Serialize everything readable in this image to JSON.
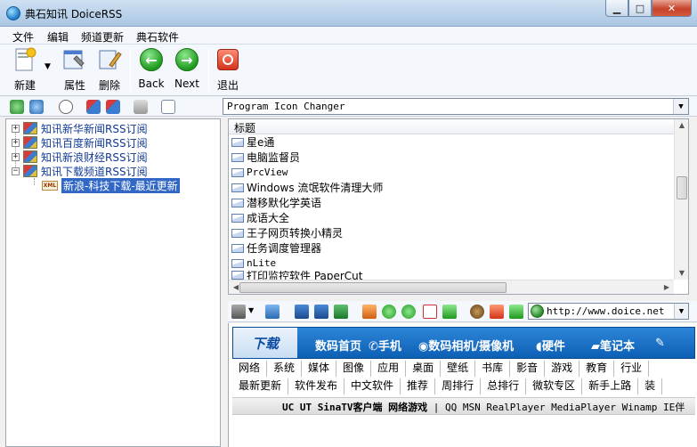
{
  "window": {
    "title": "典石知讯 DoiceRSS"
  },
  "menu": [
    "文件",
    "编辑",
    "频道更新",
    "典石软件"
  ],
  "toolbar": {
    "new_label": "新建",
    "properties_label": "属性",
    "delete_label": "删除",
    "back_label": "Back",
    "next_label": "Next",
    "exit_label": "退出"
  },
  "filter": {
    "selected": "Program Icon Changer"
  },
  "tree": {
    "items": [
      "知讯新华新闻RSS订阅",
      "知讯百度新闻RSS订阅",
      "知讯新浪财经RSS订阅",
      "知讯下载频道RSS订阅"
    ],
    "child": "新浪-科技下载-最近更新"
  },
  "list": {
    "header": "标题",
    "rows": [
      "星e通",
      "电脑监督员",
      "PrcView",
      "Windows 流氓软件清理大师",
      "潜移默化学英语",
      "成语大全",
      "王子网页转换小精灵",
      "任务调度管理器",
      "nLite",
      "打印监控软件 PaperCut"
    ]
  },
  "browser": {
    "url": "http://www.doice.net"
  },
  "web": {
    "logo": "下载",
    "nav": [
      "数码首页",
      "手机",
      "数码相机/摄像机",
      "硬件",
      "笔记本"
    ],
    "sub1": [
      "网络",
      "系统",
      "媒体",
      "图像",
      "应用",
      "桌面",
      "壁纸",
      "书库",
      "影音",
      "游戏",
      "教育",
      "行业"
    ],
    "sub2": [
      "最新更新",
      "软件发布",
      "中文软件",
      "推荐",
      "周排行",
      "总排行",
      "微软专区",
      "新手上路",
      "装"
    ],
    "banner_bold": "UC UT SinaTV客户端 网络游戏",
    "banner_rest": " | QQ MSN RealPlayer MediaPlayer Winamp IE伴"
  },
  "colors": {
    "selection": "#3168c6",
    "link": "#123a96",
    "nav_blue": "#1a6fc7"
  }
}
